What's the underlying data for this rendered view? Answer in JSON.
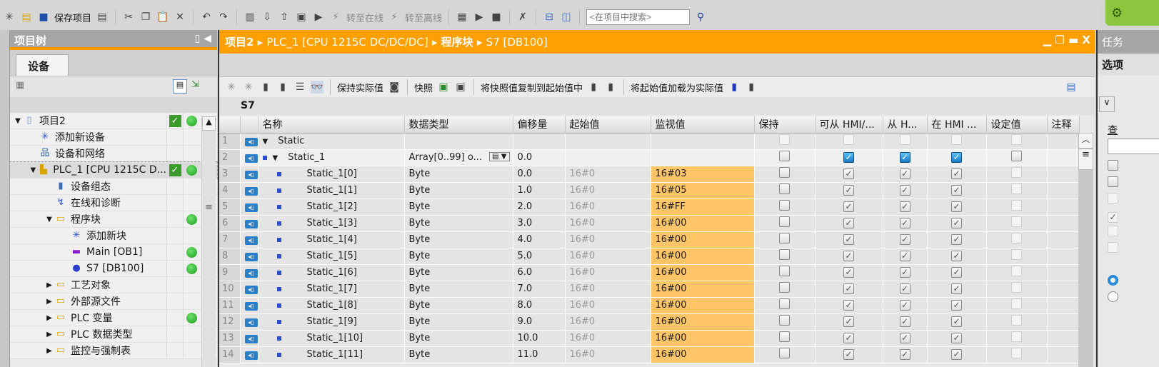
{
  "toolbar": {
    "save_label": "保存项目",
    "go_online": "转至在线",
    "go_offline": "转至离线",
    "search_placeholder": "<在项目中搜索>"
  },
  "tree": {
    "title": "项目树",
    "tab": "设备",
    "items": [
      {
        "label": "项目2",
        "level": 0,
        "arrow": "down",
        "icon": "project-icon",
        "check": true,
        "dot": true
      },
      {
        "label": "添加新设备",
        "level": 1,
        "arrow": "",
        "icon": "add-device-icon",
        "check": false,
        "dot": false
      },
      {
        "label": "设备和网络",
        "level": 1,
        "arrow": "",
        "icon": "network-icon",
        "check": false,
        "dot": false
      },
      {
        "label": "PLC_1 [CPU 1215C D...",
        "level": 1,
        "arrow": "down",
        "icon": "plc-icon",
        "check": true,
        "dot": true,
        "selected": true
      },
      {
        "label": "设备组态",
        "level": 2,
        "arrow": "",
        "icon": "device-config-icon",
        "check": false,
        "dot": false
      },
      {
        "label": "在线和诊断",
        "level": 2,
        "arrow": "",
        "icon": "diagnostics-icon",
        "check": false,
        "dot": false
      },
      {
        "label": "程序块",
        "level": 2,
        "arrow": "down",
        "icon": "folder-icon",
        "check": false,
        "dot": true
      },
      {
        "label": "添加新块",
        "level": 3,
        "arrow": "",
        "icon": "add-block-icon",
        "check": false,
        "dot": false
      },
      {
        "label": "Main [OB1]",
        "level": 3,
        "arrow": "",
        "icon": "ob-icon",
        "check": false,
        "dot": true
      },
      {
        "label": "S7 [DB100]",
        "level": 3,
        "arrow": "",
        "icon": "db-icon",
        "check": false,
        "dot": true
      },
      {
        "label": "工艺对象",
        "level": 2,
        "arrow": "right",
        "icon": "folder-icon",
        "check": false,
        "dot": false
      },
      {
        "label": "外部源文件",
        "level": 2,
        "arrow": "right",
        "icon": "folder-icon",
        "check": false,
        "dot": false
      },
      {
        "label": "PLC 变量",
        "level": 2,
        "arrow": "right",
        "icon": "folder-icon",
        "check": false,
        "dot": true
      },
      {
        "label": "PLC 数据类型",
        "level": 2,
        "arrow": "right",
        "icon": "folder-icon",
        "check": false,
        "dot": false
      },
      {
        "label": "监控与强制表",
        "level": 2,
        "arrow": "right",
        "icon": "folder-icon",
        "check": false,
        "dot": false
      }
    ]
  },
  "editor": {
    "breadcrumb": [
      "项目2",
      "PLC_1 [CPU 1215C DC/DC/DC]",
      "程序块",
      "S7 [DB100]"
    ],
    "tools": {
      "keep_actual": "保持实际值",
      "snapshot": "快照",
      "copy_snapshot": "将快照值复制到起始值中",
      "load_start": "将起始值加载为实际值"
    },
    "block_name": "S7",
    "columns": [
      "",
      "",
      "名称",
      "数据类型",
      "偏移量",
      "起始值",
      "监视值",
      "保持",
      "可从 HMI/...",
      "从 H...",
      "在 HMI ...",
      "设定值",
      "注释"
    ],
    "rows": [
      {
        "n": "1",
        "name": "Static",
        "type": "",
        "offset": "",
        "start": "",
        "monitor": "",
        "kind": "section"
      },
      {
        "n": "2",
        "name": "Static_1",
        "type": "Array[0..99] o...",
        "offset": "0.0",
        "start": "",
        "monitor": "",
        "kind": "array"
      },
      {
        "n": "3",
        "name": "Static_1[0]",
        "type": "Byte",
        "offset": "0.0",
        "start": "16#0",
        "monitor": "16#03"
      },
      {
        "n": "4",
        "name": "Static_1[1]",
        "type": "Byte",
        "offset": "1.0",
        "start": "16#0",
        "monitor": "16#05"
      },
      {
        "n": "5",
        "name": "Static_1[2]",
        "type": "Byte",
        "offset": "2.0",
        "start": "16#0",
        "monitor": "16#FF"
      },
      {
        "n": "6",
        "name": "Static_1[3]",
        "type": "Byte",
        "offset": "3.0",
        "start": "16#0",
        "monitor": "16#00"
      },
      {
        "n": "7",
        "name": "Static_1[4]",
        "type": "Byte",
        "offset": "4.0",
        "start": "16#0",
        "monitor": "16#00"
      },
      {
        "n": "8",
        "name": "Static_1[5]",
        "type": "Byte",
        "offset": "5.0",
        "start": "16#0",
        "monitor": "16#00"
      },
      {
        "n": "9",
        "name": "Static_1[6]",
        "type": "Byte",
        "offset": "6.0",
        "start": "16#0",
        "monitor": "16#00"
      },
      {
        "n": "10",
        "name": "Static_1[7]",
        "type": "Byte",
        "offset": "7.0",
        "start": "16#0",
        "monitor": "16#00"
      },
      {
        "n": "11",
        "name": "Static_1[8]",
        "type": "Byte",
        "offset": "8.0",
        "start": "16#0",
        "monitor": "16#00"
      },
      {
        "n": "12",
        "name": "Static_1[9]",
        "type": "Byte",
        "offset": "9.0",
        "start": "16#0",
        "monitor": "16#00"
      },
      {
        "n": "13",
        "name": "Static_1[10]",
        "type": "Byte",
        "offset": "10.0",
        "start": "16#0",
        "monitor": "16#00"
      },
      {
        "n": "14",
        "name": "Static_1[11]",
        "type": "Byte",
        "offset": "11.0",
        "start": "16#0",
        "monitor": "16#00"
      }
    ]
  },
  "right_panel": {
    "title": "任务",
    "tab": "选项",
    "find_label": "查"
  },
  "colors": {
    "accent": "#ffa000",
    "monitor_bg": "#ffc566",
    "status_ok": "#3a9b2a"
  }
}
